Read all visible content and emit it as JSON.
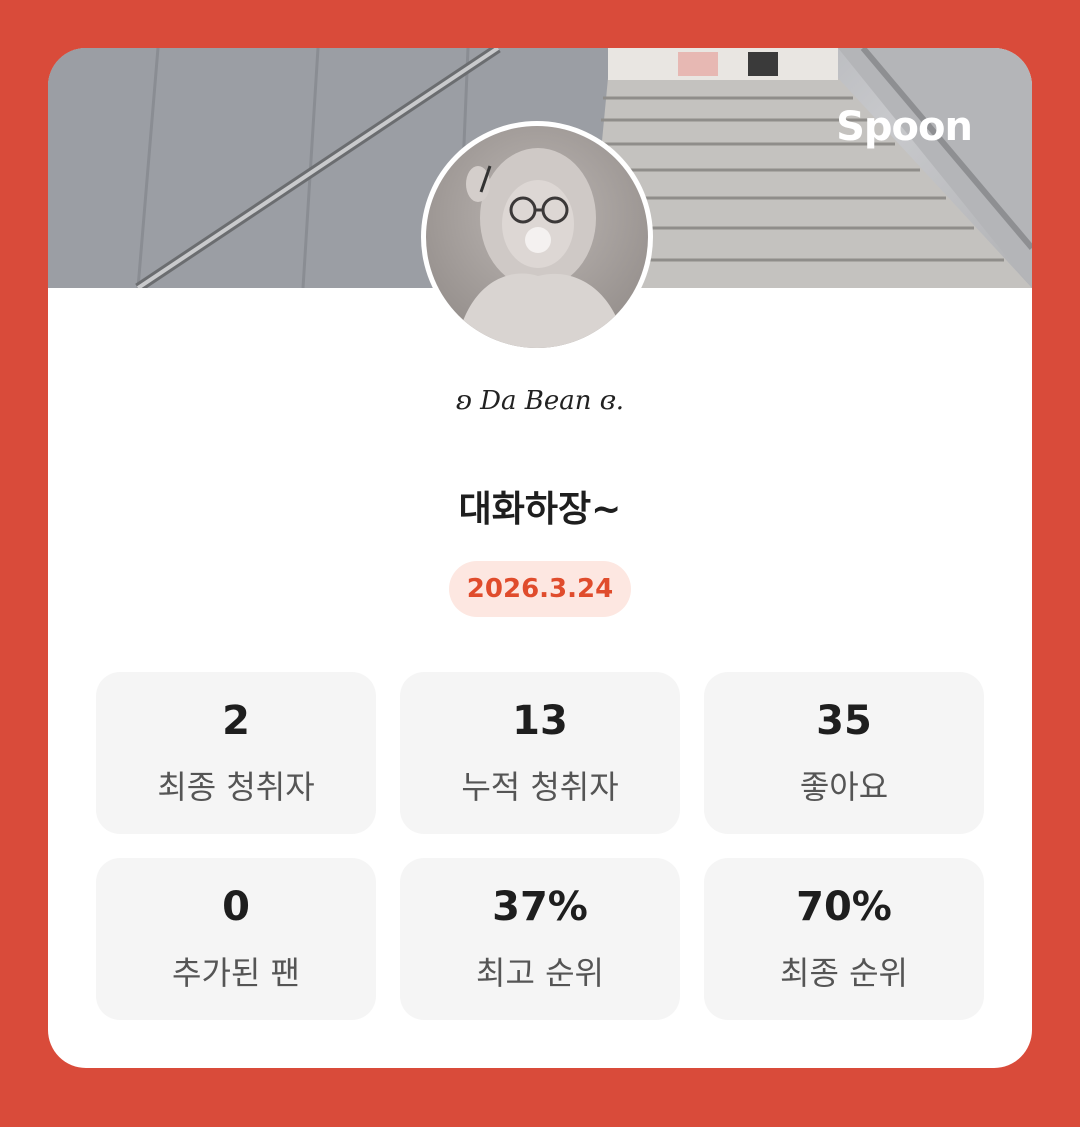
{
  "brand": {
    "logo_text": "Spoon"
  },
  "profile": {
    "signature": "ʚ Da Bean ɞ.",
    "title": "대화하장~",
    "date": "2026.3.24"
  },
  "stats": [
    {
      "value": "2",
      "label": "최종 청취자"
    },
    {
      "value": "13",
      "label": "누적 청취자"
    },
    {
      "value": "35",
      "label": "좋아요"
    },
    {
      "value": "0",
      "label": "추가된 팬"
    },
    {
      "value": "37%",
      "label": "최고 순위"
    },
    {
      "value": "70%",
      "label": "최종 순위"
    }
  ],
  "colors": {
    "background": "#d94b3a",
    "card": "#ffffff",
    "accent": "#e04c2c",
    "badge_bg": "#fde7e1",
    "tile_bg": "#f5f5f5"
  }
}
